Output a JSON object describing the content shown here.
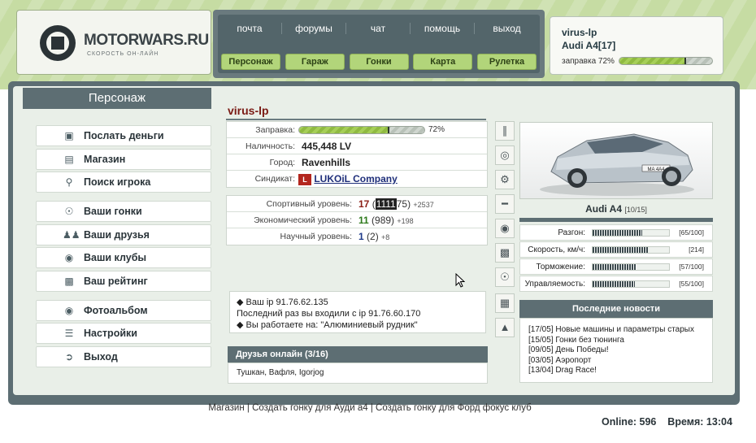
{
  "logo": {
    "text": "MOTORWARS.RU",
    "slogan": "СКОРОСТЬ ОН-ЛАЙН"
  },
  "topnav": {
    "links": [
      "почта",
      "форумы",
      "чат",
      "помощь",
      "выход"
    ],
    "buttons": [
      "Персонаж",
      "Гараж",
      "Гонки",
      "Карта",
      "Рулетка"
    ]
  },
  "userbox": {
    "username": "virus-lp",
    "car": "Audi A4[17]",
    "fuel_label": "заправка 72%",
    "fuel_level": 0.72
  },
  "sidebar": {
    "title": "Персонаж",
    "items": [
      {
        "label": "Послать деньги",
        "icon": "money-icon"
      },
      {
        "label": "Магазин",
        "icon": "shop-icon"
      },
      {
        "label": "Поиск игрока",
        "icon": "search-icon"
      },
      {
        "label": "Ваши гонки",
        "icon": "steering-wheel-icon"
      },
      {
        "label": "Ваши друзья",
        "icon": "friends-icon"
      },
      {
        "label": "Ваши клубы",
        "icon": "clubs-icon"
      },
      {
        "label": "Ваш рейтинг",
        "icon": "rating-chart-icon"
      },
      {
        "label": "Фотоальбом",
        "icon": "photo-icon"
      },
      {
        "label": "Настройки",
        "icon": "settings-sliders-icon"
      },
      {
        "label": "Выход",
        "icon": "exit-icon"
      }
    ]
  },
  "player": {
    "name": "virus-lp",
    "fuel": {
      "label": "Заправка:",
      "value": "72%",
      "level": 0.72
    },
    "cash": {
      "label": "Наличность:",
      "value": "445,448 LV"
    },
    "city": {
      "label": "Город:",
      "value": "Ravenhills"
    },
    "syndicate": {
      "label": "Синдикат:",
      "value": "LUKOiL Company"
    },
    "levels": [
      {
        "label": "Спортивный уровень:",
        "level": "17",
        "paren_open": "(",
        "points_hl": "1111",
        "points_rest": "75)",
        "add": "+2537",
        "color": "#8b1e15"
      },
      {
        "label": "Экономический уровень:",
        "level": "11",
        "paren_open": "(",
        "points_hl": "",
        "points_rest": "989)",
        "add": "+198",
        "color": "#2e7a1c"
      },
      {
        "label": "Научный уровень:",
        "level": "1",
        "paren_open": "(",
        "points_hl": "",
        "points_rest": "2)",
        "add": "+8",
        "color": "#1f3a8a"
      }
    ]
  },
  "messages": {
    "ip": "Ваш ip 91.76.62.135",
    "last_login": "Последний раз вы входили с ip 91.76.60.170",
    "work": "Вы работаете на: \"Алюминиевый рудник\""
  },
  "friends": {
    "title": "Друзья онлайн (3/16)",
    "list": "Тушкан, Вафля, Igorjog"
  },
  "car": {
    "name": "Audi A4",
    "level": "[10/15]",
    "plate": "MA 4A4",
    "stats": [
      {
        "label": "Разгон:",
        "value": "[65/100]",
        "level": 0.65
      },
      {
        "label": "Скорость, км/ч:",
        "value": "[214]",
        "level": 0.72
      },
      {
        "label": "Торможение:",
        "value": "[57/100]",
        "level": 0.57
      },
      {
        "label": "Управляемость:",
        "value": "[55/100]",
        "level": 0.55
      }
    ]
  },
  "news": {
    "title": "Последние новости",
    "items": [
      "[17/05] Новые машины и параметры старых",
      "[15/05] Гонки без тюнинга",
      "[09/05] День Победы!",
      "[03/05] Аэропорт",
      "[13/04] Drag Race!"
    ]
  },
  "footer": {
    "links": [
      "Магазин",
      "Создать гонку для Ауди а4",
      "Создать гонку для Форд фокус клуб"
    ],
    "separator": " | ",
    "online": "Online: 596",
    "time": "Время: 13:04"
  }
}
